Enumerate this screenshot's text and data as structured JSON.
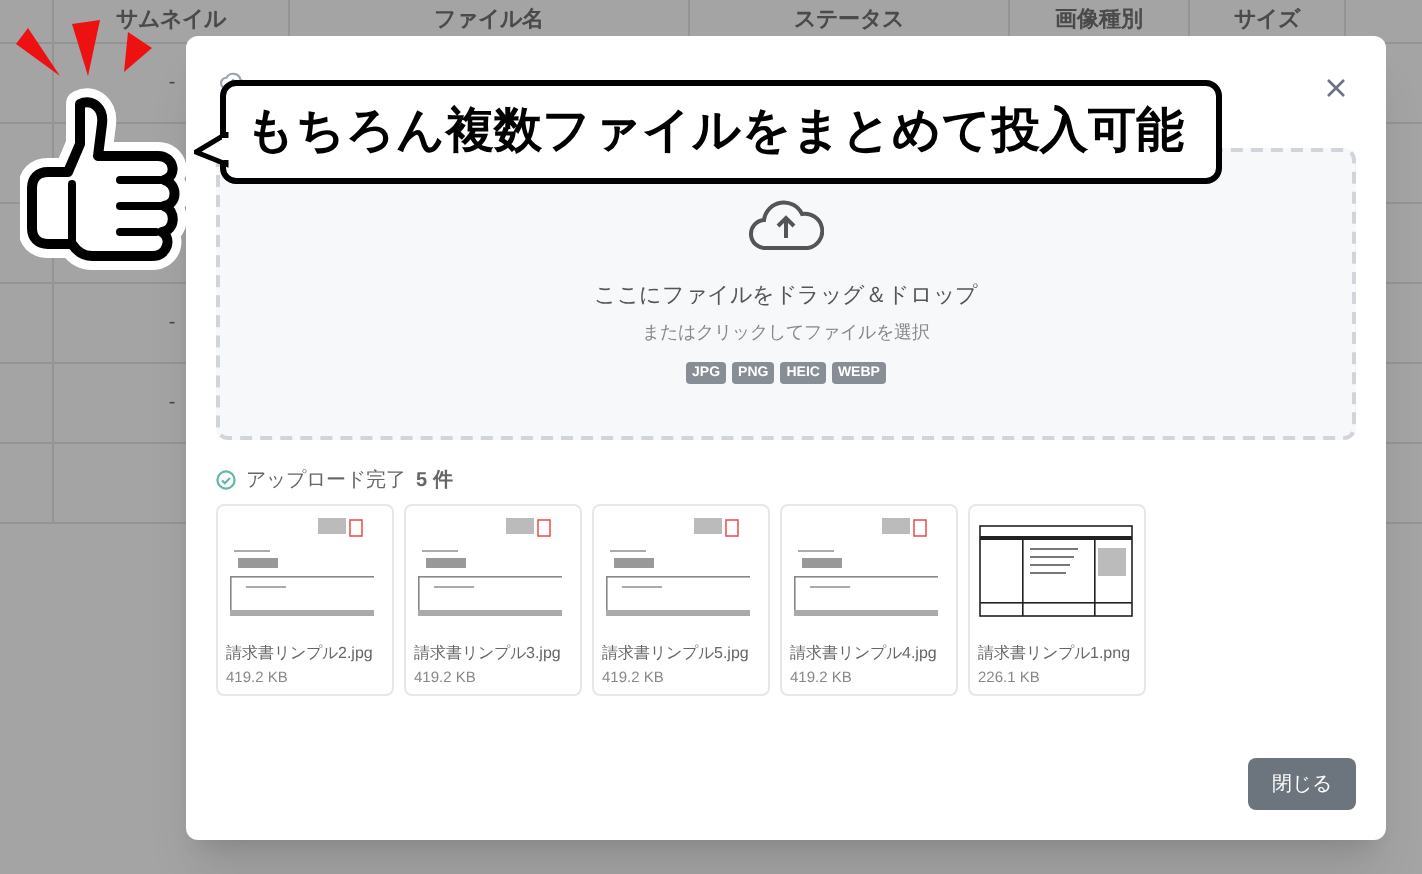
{
  "table": {
    "columns": [
      "サムネイル",
      "ファイル名",
      "ステータス",
      "画像種別",
      "サイズ"
    ],
    "rows": [
      {
        "thumbnail": "-"
      },
      {},
      {},
      {
        "thumbnail": "-"
      },
      {
        "thumbnail": "-"
      },
      {}
    ]
  },
  "dialog": {
    "dropzone": {
      "heading": "ここにファイルをドラッグ＆ドロップ",
      "hint": "またはクリックしてファイルを選択",
      "formats": [
        "JPG",
        "PNG",
        "HEIC",
        "WEBP"
      ]
    },
    "status": {
      "label": "アップロード完了",
      "count": "5 件"
    },
    "files": [
      {
        "name": "請求書リンプル2.jpg",
        "size": "419.2 KB"
      },
      {
        "name": "請求書リンプル3.jpg",
        "size": "419.2 KB"
      },
      {
        "name": "請求書リンプル5.jpg",
        "size": "419.2 KB"
      },
      {
        "name": "請求書リンプル4.jpg",
        "size": "419.2 KB"
      },
      {
        "name": "請求書リンプル1.png",
        "size": "226.1 KB"
      }
    ],
    "close_button": "閉じる"
  },
  "callout": {
    "text": "もちろん複数ファイルをまとめて投入可能"
  }
}
